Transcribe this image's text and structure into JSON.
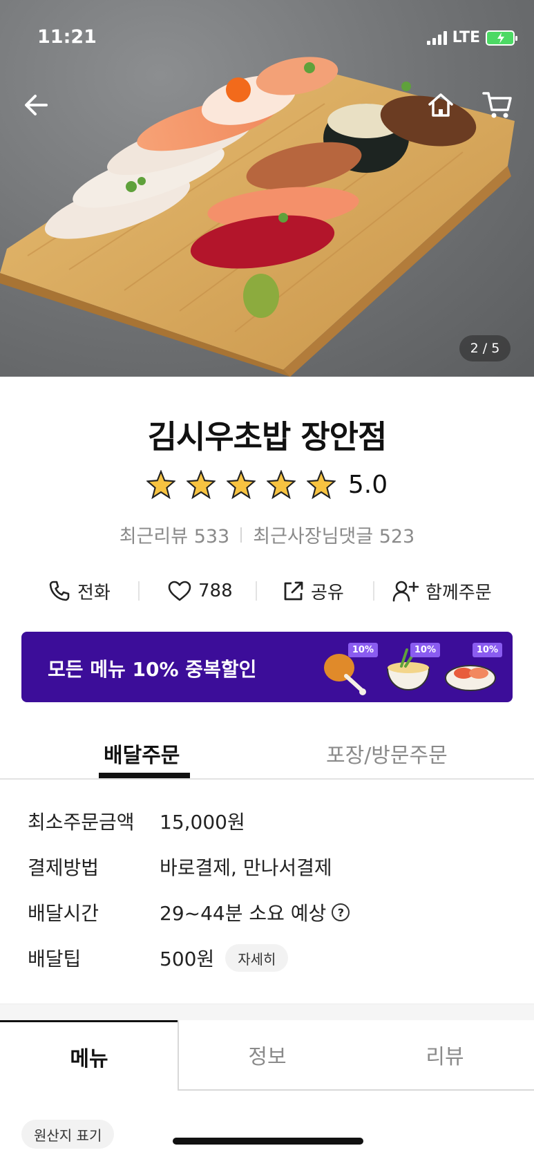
{
  "status": {
    "time": "11:21",
    "network": "LTE"
  },
  "hero": {
    "page_indicator": "2 / 5"
  },
  "store": {
    "name": "김시우초밥 장안점",
    "rating": "5.0",
    "stars": 5,
    "recent_reviews": "최근리뷰 533",
    "owner_replies": "최근사장님댓글 523"
  },
  "actions": {
    "call": "전화",
    "likes": "788",
    "share": "공유",
    "group_order": "함께주문"
  },
  "promo": {
    "text": "모든 메뉴 10% 중복할인",
    "badge": "10%",
    "bg_color": "#3c0d99"
  },
  "order_tabs": {
    "delivery": "배달주문",
    "pickup": "포장/방문주문"
  },
  "info": [
    {
      "label": "최소주문금액",
      "value": "15,000원"
    },
    {
      "label": "결제방법",
      "value": "바로결제, 만나서결제"
    },
    {
      "label": "배달시간",
      "value": "29~44분 소요 예상"
    },
    {
      "label": "배달팁",
      "value": "500원"
    }
  ],
  "info_detail_button": "자세히",
  "menu_tabs": {
    "menu": "메뉴",
    "info": "정보",
    "review": "리뷰"
  },
  "origin_label": "원산지 표기"
}
